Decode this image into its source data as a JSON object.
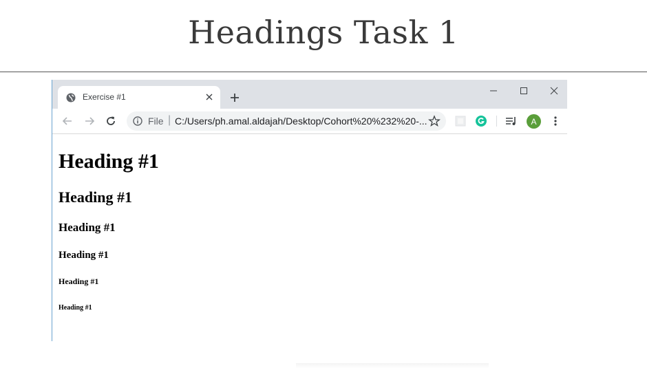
{
  "slide": {
    "title": "Headings Task 1"
  },
  "browser": {
    "tab": {
      "title": "Exercise #1"
    },
    "address": {
      "scheme": "File",
      "url": "C:/Users/ph.amal.aldajah/Desktop/Cohort%20%232%20-..."
    },
    "profile": {
      "initial": "A"
    },
    "colors": {
      "tabstrip": "#dee1e6",
      "avatar": "#5a9e3a",
      "grammarly": "#15c39a"
    }
  },
  "page": {
    "headings": [
      "Heading #1",
      "Heading #1",
      "Heading #1",
      "Heading #1",
      "Heading #1",
      "Heading #1"
    ]
  }
}
